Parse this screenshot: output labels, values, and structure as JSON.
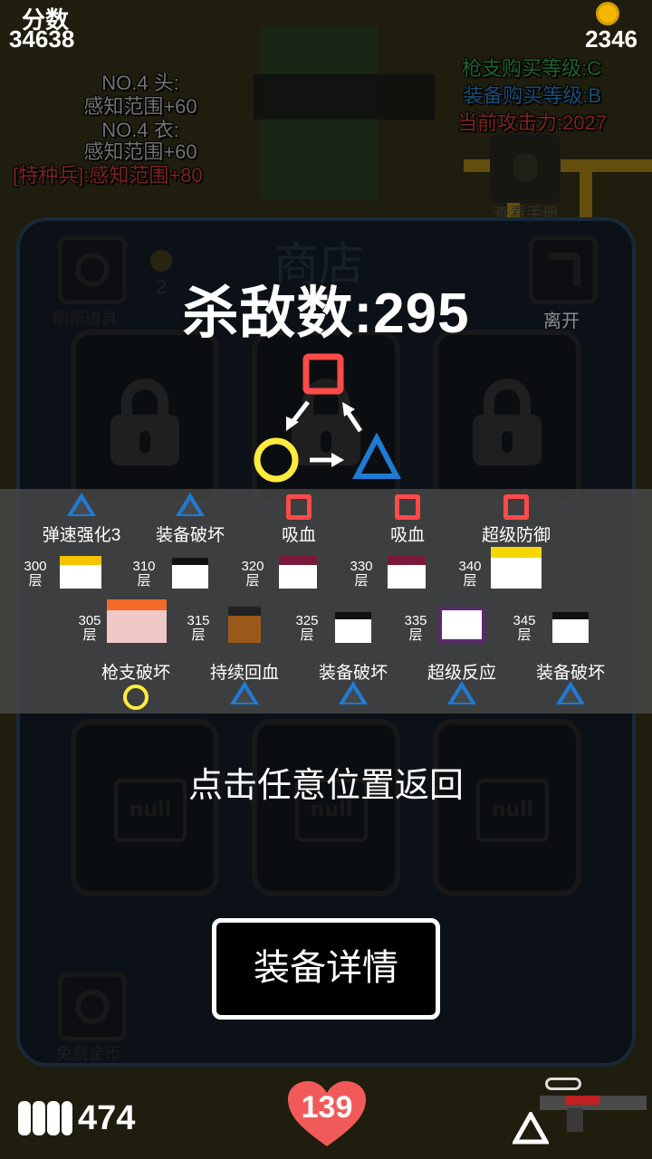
{
  "hud": {
    "score_label": "分数",
    "score_value": "34638",
    "coins": "2346",
    "ammo": "474",
    "health": "139"
  },
  "background": {
    "gun_level": "枪支购买等级:C",
    "gear_level": "装备购买等级:B",
    "attack": "当前攻击力:2027",
    "stat1_title": "NO.4 头:",
    "stat1_value": "感知范围+60",
    "stat2_title": "NO.4 衣:",
    "stat2_value": "感知范围+60",
    "stat3": "[特种兵]:感知范围+80",
    "shop_title": "商店",
    "refresh_label": "刷新道具",
    "refresh_cost": "2",
    "leave_label": "离开",
    "free_coins_label": "免费金币",
    "view_label": "查看手册"
  },
  "overlay": {
    "kills": "杀敌数:295",
    "return_hint": "点击任意位置返回",
    "detail_button": "装备详情"
  },
  "top_items": [
    {
      "label": "弹速强化3",
      "floor": "300",
      "type": "triangle"
    },
    {
      "label": "装备破坏",
      "floor": "310",
      "type": "triangle"
    },
    {
      "label": "吸血",
      "floor": "320",
      "type": "square"
    },
    {
      "label": "吸血",
      "floor": "330",
      "type": "square"
    },
    {
      "label": "超级防御",
      "floor": "340",
      "type": "square"
    }
  ],
  "bottom_items": [
    {
      "label": "枪支破坏",
      "floor": "305",
      "type": "circle"
    },
    {
      "label": "持续回血",
      "floor": "315",
      "type": "triangle"
    },
    {
      "label": "装备破坏",
      "floor": "325",
      "type": "triangle"
    },
    {
      "label": "超级反应",
      "floor": "335",
      "type": "triangle"
    },
    {
      "label": "装备破坏",
      "floor": "345",
      "type": "triangle"
    }
  ],
  "floor_unit": "层",
  "null_label": "null",
  "colors": {
    "square": "#ff4a4a",
    "triangle": "#1f7bd4",
    "circle": "#ffeb3b",
    "panel_border": "#2f4a68"
  }
}
